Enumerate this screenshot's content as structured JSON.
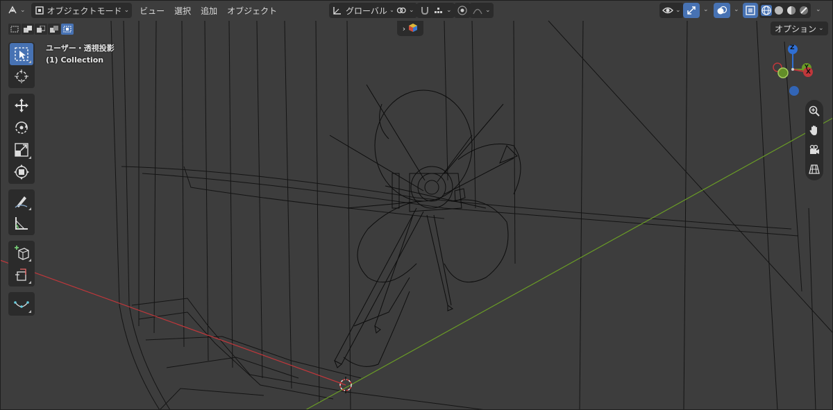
{
  "header": {
    "editor_type_icon": "3d-viewport-icon",
    "mode_label": "オブジェクトモード",
    "menus": [
      "ビュー",
      "選択",
      "追加",
      "オブジェクト"
    ],
    "transform_orientation": "グローバル",
    "options_label": "オプション"
  },
  "viewport_overlay": {
    "view_name": "ユーザー・透視投影",
    "collection_label": "(1) Collection"
  },
  "axis_gizmo": {
    "z_label": "Z",
    "y_label": "Y",
    "x_label": "X"
  },
  "colors": {
    "viewport_bg": "#3d3d3d",
    "header_bg": "#2b2b2b",
    "accent_blue": "#4772b3",
    "x_axis_red": "#c0373b",
    "y_axis_green": "#6a9c26",
    "z_axis_blue": "#2f6fd4",
    "wire_black": "#0d0d0d"
  },
  "toolbar": {
    "tools": [
      "select-box-icon",
      "cursor-icon",
      "move-icon",
      "rotate-icon",
      "scale-icon",
      "transform-icon",
      "annotate-icon",
      "measure-icon",
      "add-cube-icon",
      "add-object-icon",
      "edit-curve-icon"
    ],
    "active_tool": "select-box-icon"
  },
  "nav_buttons": [
    "zoom-icon",
    "pan-hand-icon",
    "camera-icon",
    "ortho-grid-icon"
  ]
}
